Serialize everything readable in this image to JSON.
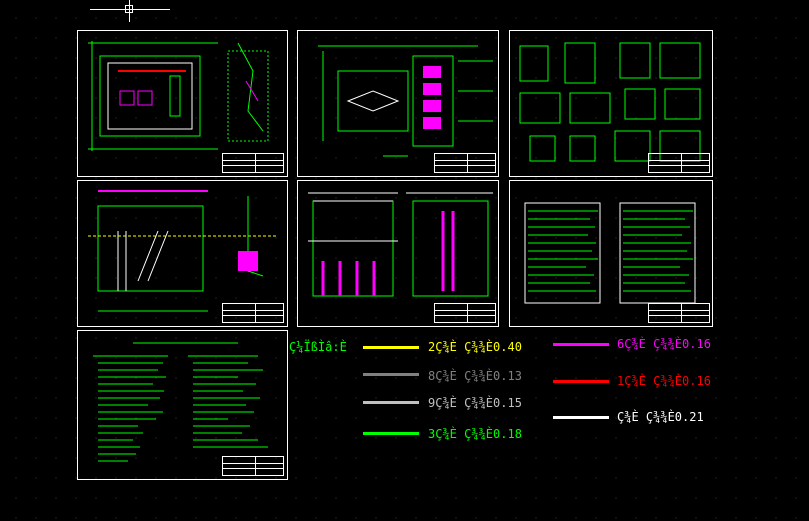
{
  "legend": {
    "title": "Ç¼ÏßÌâ:È",
    "items": [
      {
        "label": "2Ç¾­È  Ç¾¾È0.40",
        "color": "#ffff00"
      },
      {
        "label": "8Ç¾­È  Ç¾¾È0.13",
        "color": "#808080"
      },
      {
        "label": "9Ç¾­È  Ç¾¾È0.15",
        "color": "#c0c0c0"
      },
      {
        "label": "3Ç¾­È  Ç¾¾È0.18",
        "color": "#00ff00"
      },
      {
        "label": "6Ç¾­È  Ç¾¾È0.16",
        "color": "#ff00ff"
      },
      {
        "label": "1Ç¾­È  Ç¾¾È0.16",
        "color": "#ff0000"
      },
      {
        "label": "Ç¾­È  Ç¾¾È0.21",
        "color": "#ffffff"
      }
    ]
  },
  "colors": {
    "background": "#000000",
    "frame": "#ffffff",
    "drawing_primary": "#00ff00",
    "drawing_accent": "#ff00ff",
    "drawing_red": "#ff0000"
  },
  "sheets": [
    {
      "id": "sheet-plan"
    },
    {
      "id": "sheet-section-plan"
    },
    {
      "id": "sheet-details"
    },
    {
      "id": "sheet-elevation-a"
    },
    {
      "id": "sheet-elevation-b"
    },
    {
      "id": "sheet-tables"
    },
    {
      "id": "sheet-notes"
    }
  ]
}
